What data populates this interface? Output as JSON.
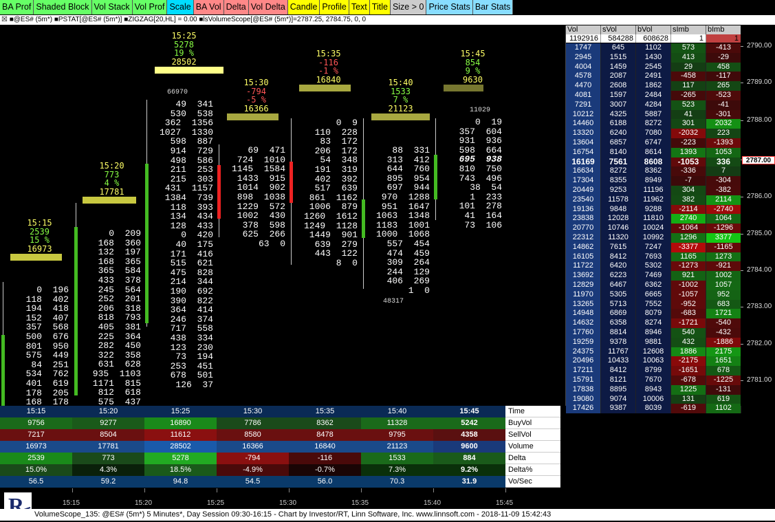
{
  "toolbar": [
    {
      "label": "BA Prof",
      "bg": "#66ff66"
    },
    {
      "label": "Shaded Block",
      "bg": "#66ff66"
    },
    {
      "label": "Vol Stack",
      "bg": "#66ff66"
    },
    {
      "label": "Vol Prof",
      "bg": "#66ff66"
    },
    {
      "label": "Scale",
      "bg": "#00ddff"
    },
    {
      "label": "BA Vol",
      "bg": "#ff8888"
    },
    {
      "label": "Delta",
      "bg": "#ff8888"
    },
    {
      "label": "Vol Delta",
      "bg": "#ff8888"
    },
    {
      "label": "Candle",
      "bg": "#ffff00"
    },
    {
      "label": "Profile",
      "bg": "#ffff00"
    },
    {
      "label": "Text",
      "bg": "#ffff00"
    },
    {
      "label": "Title",
      "bg": "#ffff00"
    },
    {
      "label": "Size > 0",
      "bg": "#cccccc"
    },
    {
      "label": "Price Stats",
      "bg": "#88ddff"
    },
    {
      "label": "Bar Stats",
      "bg": "#88ddff"
    }
  ],
  "titlebar": "☒ ■@ES# (5m*) ■PSTAT[@ES# (5m*)] ■ZIGZAG[20,HL] = 0.00 ■lsVolumeScope[@ES# (5m*)]=2787.25, 2784.75, 0, 0",
  "bars": [
    {
      "time": "15:15",
      "vol": "2539",
      "pct": "15 %",
      "total": "16973",
      "color": "#ffff66",
      "dcolor": "#88ff44"
    },
    {
      "time": "15:20",
      "vol": "773",
      "pct": "4 %",
      "total": "17781",
      "color": "#ffff66",
      "dcolor": "#88ff44"
    },
    {
      "time": "15:25",
      "vol": "5278",
      "pct": "19 %",
      "total": "28502",
      "color": "#ffff66",
      "dcolor": "#88ff44"
    },
    {
      "time": "15:30",
      "vol": "-794",
      "pct": "-5 %",
      "total": "16366",
      "color": "#ffff66",
      "dcolor": "#ff5555"
    },
    {
      "time": "15:35",
      "vol": "-116",
      "pct": "-1 %",
      "total": "16840",
      "color": "#ffff66",
      "dcolor": "#ff5555"
    },
    {
      "time": "15:40",
      "vol": "1533",
      "pct": "7 %",
      "total": "21123",
      "color": "#ffff66",
      "dcolor": "#88ff44"
    },
    {
      "time": "15:45",
      "vol": "854",
      "pct": "9 %",
      "total": "9630",
      "color": "#ffff66",
      "dcolor": "#88ff44"
    }
  ],
  "bigvols": [
    "66970",
    "11029",
    "48317"
  ],
  "footprints": [
    [
      "0  196",
      "118  402",
      "194  418",
      "152  407",
      "357  568",
      "500  676",
      "801  950",
      "575  449",
      "84  251",
      "534  762",
      "401  619",
      "178  205",
      "168  178"
    ],
    [
      "0  209",
      "168  360",
      "132  197",
      "168  365",
      "365  584",
      "433  378",
      "245  564",
      "252  201",
      "206  318",
      "818  793",
      "405  381",
      "225  364",
      "282  450",
      "322  358",
      "631  628",
      "935  1103",
      "1171  815",
      "812  618",
      "575  437"
    ],
    [
      "49  341",
      "530  538",
      "362  1356",
      "1027  1330",
      "598  887",
      "914  729",
      "498  586",
      "211  253",
      "215  303",
      "431  1157",
      "1384  739",
      "118  393",
      "134  434",
      "128  433",
      "0  420",
      "40  175",
      "171  416",
      "515  621",
      "475  828",
      "214  344",
      "190  692",
      "390  822",
      "364  414",
      "246  374",
      "717  558",
      "438  334",
      "123  230",
      "73  194",
      "253  451",
      "678  501",
      "126  37"
    ],
    [
      "69  471",
      "724  1010",
      "1145  1584",
      "1433  915",
      "1014  902",
      "898  1038",
      "1229  572",
      "1002  430",
      "378  598",
      "625  266",
      "63  0"
    ],
    [
      "0  9",
      "110  228",
      "83  172",
      "206  172",
      "54  348",
      "191  319",
      "402  392",
      "517  639",
      "861  1162",
      "1006  879",
      "1260  1612",
      "1249  1128",
      "1449  901",
      "639  279",
      "443  122",
      "8  0"
    ],
    [
      "88  331",
      "313  412",
      "644  760",
      "895  954",
      "697  944",
      "970  1288",
      "951  1647",
      "1063  1348",
      "1183  1001",
      "1000  1068",
      "557  454",
      "474  459",
      "309  264",
      "244  129",
      "406  269",
      "1  0"
    ],
    [
      "0  19",
      "357  604",
      "931  936",
      "598  664",
      "695  938",
      "810  750",
      "743  496",
      "38  54",
      "1  233",
      "101  278",
      "41  164",
      "73  106"
    ]
  ],
  "pricetable": {
    "headers": [
      "Vol",
      "sVol",
      "bVol",
      "sImb",
      "bImb"
    ],
    "totals": [
      "1192916",
      "584288",
      "608628",
      "1",
      "1"
    ],
    "rows": [
      [
        "1747",
        "645",
        "1102",
        "573",
        "-413"
      ],
      [
        "2945",
        "1515",
        "1430",
        "413",
        "-29"
      ],
      [
        "4004",
        "1459",
        "2545",
        "29",
        "458"
      ],
      [
        "4578",
        "2087",
        "2491",
        "-458",
        "-117"
      ],
      [
        "4470",
        "2608",
        "1862",
        "117",
        "265"
      ],
      [
        "4081",
        "1597",
        "2484",
        "-265",
        "-523"
      ],
      [
        "7291",
        "3007",
        "4284",
        "523",
        "-41"
      ],
      [
        "10212",
        "4325",
        "5887",
        "41",
        "-301"
      ],
      [
        "14460",
        "6188",
        "8272",
        "301",
        "2032"
      ],
      [
        "13320",
        "6240",
        "7080",
        "-2032",
        "223"
      ],
      [
        "13604",
        "6857",
        "6747",
        "-223",
        "-1393"
      ],
      [
        "16754",
        "8140",
        "8614",
        "1393",
        "1053"
      ],
      [
        "16169",
        "7561",
        "8608",
        "-1053",
        "336"
      ],
      [
        "16634",
        "8272",
        "8362",
        "-336",
        "7"
      ],
      [
        "17304",
        "8355",
        "8949",
        "-7",
        "-304"
      ],
      [
        "20449",
        "9253",
        "11196",
        "304",
        "-382"
      ],
      [
        "23540",
        "11578",
        "11962",
        "382",
        "2114"
      ],
      [
        "19136",
        "9848",
        "9288",
        "-2114",
        "-2740"
      ],
      [
        "23838",
        "12028",
        "11810",
        "2740",
        "1064"
      ],
      [
        "20770",
        "10746",
        "10024",
        "-1064",
        "-1296"
      ],
      [
        "22312",
        "11320",
        "10992",
        "1296",
        "3377"
      ],
      [
        "14862",
        "7615",
        "7247",
        "-3377",
        "-1165"
      ],
      [
        "16105",
        "8412",
        "7693",
        "1165",
        "1273"
      ],
      [
        "11722",
        "6420",
        "5302",
        "-1273",
        "-921"
      ],
      [
        "13692",
        "6223",
        "7469",
        "921",
        "1002"
      ],
      [
        "12829",
        "6467",
        "6362",
        "-1002",
        "1057"
      ],
      [
        "11970",
        "5305",
        "6665",
        "-1057",
        "952"
      ],
      [
        "13265",
        "5713",
        "7552",
        "-952",
        "683"
      ],
      [
        "14948",
        "6869",
        "8079",
        "-683",
        "1721"
      ],
      [
        "14632",
        "6358",
        "8274",
        "-1721",
        "-540"
      ],
      [
        "17760",
        "8814",
        "8946",
        "540",
        "-432"
      ],
      [
        "19259",
        "9378",
        "9881",
        "432",
        "-1886"
      ],
      [
        "24375",
        "11767",
        "12608",
        "1886",
        "2175"
      ],
      [
        "20496",
        "10433",
        "10063",
        "-2175",
        "1651"
      ],
      [
        "17211",
        "8412",
        "8799",
        "-1651",
        "678"
      ],
      [
        "15791",
        "8121",
        "7670",
        "-678",
        "-1225"
      ],
      [
        "17838",
        "8895",
        "8943",
        "1225",
        "-131"
      ],
      [
        "19080",
        "9074",
        "10006",
        "131",
        "619"
      ],
      [
        "17426",
        "9387",
        "8039",
        "-619",
        "1102"
      ]
    ]
  },
  "pricescale": [
    "2790.00",
    "2789.00",
    "2788.00",
    "2787.00",
    "2786.00",
    "2785.00",
    "2784.00",
    "2783.00",
    "2782.00",
    "2781.00"
  ],
  "current_price": "2787.00",
  "stats": {
    "times": [
      "15:15",
      "15:20",
      "15:25",
      "15:30",
      "15:35",
      "15:40",
      "15:45"
    ],
    "rows": [
      {
        "label": "Time",
        "values": [
          "15:15",
          "15:20",
          "15:25",
          "15:30",
          "15:35",
          "15:40",
          "15:45"
        ]
      },
      {
        "label": "BuyVol",
        "values": [
          "9756",
          "9277",
          "16890",
          "7786",
          "8362",
          "11328",
          "5242"
        ]
      },
      {
        "label": "SellVol",
        "values": [
          "7217",
          "8504",
          "11612",
          "8580",
          "8478",
          "9795",
          "4358"
        ]
      },
      {
        "label": "Volume",
        "values": [
          "16973",
          "17781",
          "28502",
          "16366",
          "16840",
          "21123",
          "9600"
        ]
      },
      {
        "label": "Delta",
        "values": [
          "2539",
          "773",
          "5278",
          "-794",
          "-116",
          "1533",
          "884"
        ]
      },
      {
        "label": "Delta%",
        "values": [
          "15.0%",
          "4.3%",
          "18.5%",
          "-4.9%",
          "-0.7%",
          "7.3%",
          "9.2%"
        ]
      },
      {
        "label": "Vo/Sec",
        "values": [
          "56.5",
          "59.2",
          "94.8",
          "54.5",
          "56.0",
          "70.3",
          "31.9"
        ]
      }
    ]
  },
  "timeaxis": [
    "15:15",
    "15:20",
    "15:25",
    "15:30",
    "15:35",
    "15:40",
    "15:45"
  ],
  "status": "VolumeScope_135: @ES# (5m*) 5 Minutes*, Day Session 09:30-16:15 - Chart by Investor/RT, Linn Software, Inc. www.linnsoft.com - 2018-11-09 15:42:43"
}
